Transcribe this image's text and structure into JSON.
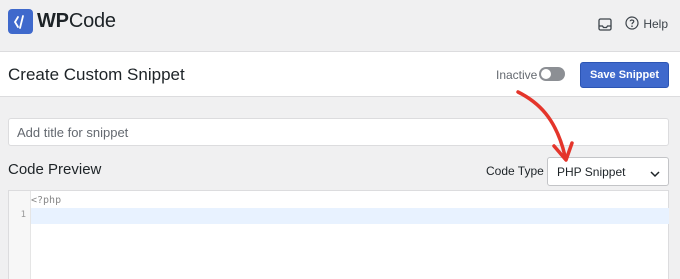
{
  "app": {
    "logo_text_bold": "WP",
    "logo_text_rest": "Code",
    "help_label": "Help"
  },
  "header": {
    "title": "Create Custom Snippet",
    "status_label": "Inactive",
    "toggle_on": false,
    "save_label": "Save Snippet"
  },
  "form": {
    "title_placeholder": "Add title for snippet",
    "title_value": "",
    "code_preview_label": "Code Preview",
    "code_type_label": "Code Type",
    "code_type_selected": "PHP Snippet"
  },
  "editor": {
    "lines": [
      {
        "number": "",
        "text": "<?php"
      },
      {
        "number": "1",
        "text": ""
      }
    ]
  },
  "colors": {
    "accent": "#3f69cc",
    "annotation_arrow": "#e4352b"
  },
  "icons": {
    "logo": "wpcode-logo-icon",
    "inbox": "inbox-icon",
    "help": "help-circle-icon",
    "select_chevron": "chevron-down-icon"
  }
}
